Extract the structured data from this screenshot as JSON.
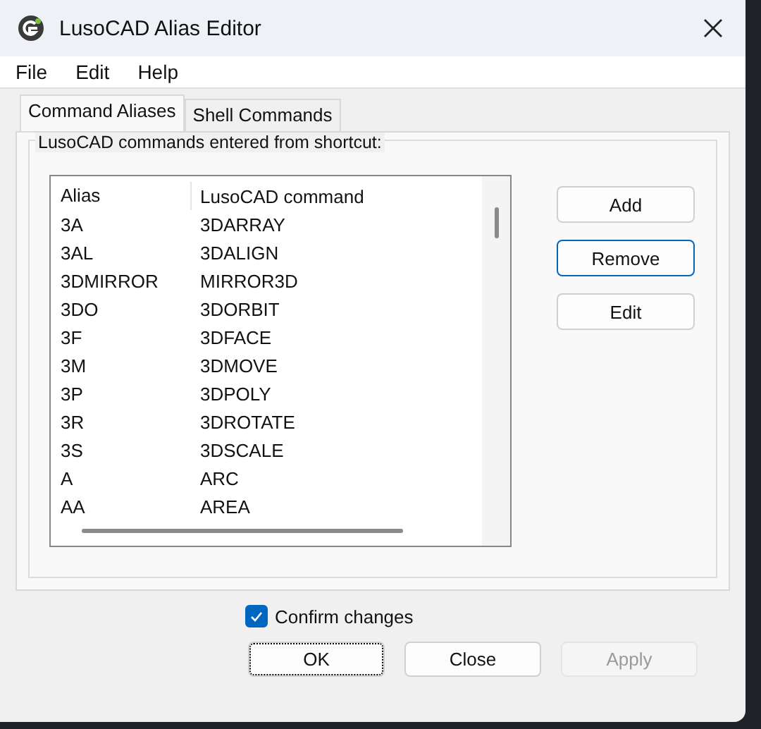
{
  "window": {
    "title": "LusoCAD Alias Editor"
  },
  "menu": [
    "File",
    "Edit",
    "Help"
  ],
  "tabs": [
    {
      "label": "Command Aliases",
      "selected": true
    },
    {
      "label": "Shell Commands",
      "selected": false
    }
  ],
  "group": {
    "title": "LusoCAD commands entered from shortcut:"
  },
  "table": {
    "columns": [
      "Alias",
      "LusoCAD command"
    ],
    "rows": [
      [
        "3A",
        "3DARRAY"
      ],
      [
        "3AL",
        "3DALIGN"
      ],
      [
        "3DMIRROR",
        "MIRROR3D"
      ],
      [
        "3DO",
        "3DORBIT"
      ],
      [
        "3F",
        "3DFACE"
      ],
      [
        "3M",
        "3DMOVE"
      ],
      [
        "3P",
        "3DPOLY"
      ],
      [
        "3R",
        "3DROTATE"
      ],
      [
        "3S",
        "3DSCALE"
      ],
      [
        "A",
        "ARC"
      ],
      [
        "AA",
        "AREA"
      ]
    ]
  },
  "side_buttons": [
    {
      "label": "Add",
      "focused": false
    },
    {
      "label": "Remove",
      "focused": true
    },
    {
      "label": "Edit",
      "focused": false
    }
  ],
  "confirm": {
    "label": "Confirm changes",
    "checked": true
  },
  "buttons": [
    {
      "label": "OK",
      "focused": true,
      "disabled": false
    },
    {
      "label": "Close",
      "focused": false,
      "disabled": false
    },
    {
      "label": "Apply",
      "focused": false,
      "disabled": true
    }
  ]
}
